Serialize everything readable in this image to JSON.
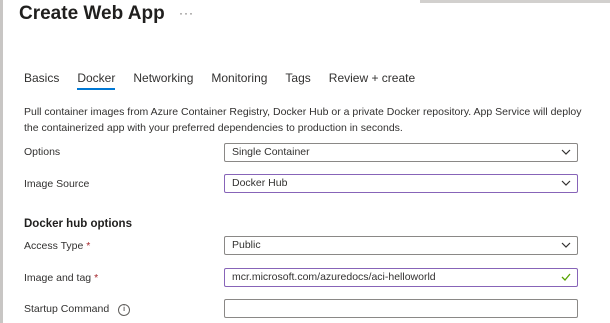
{
  "window": {
    "title": "Create Web App",
    "more_label": "···"
  },
  "tabs": [
    {
      "label": "Basics"
    },
    {
      "label": "Docker",
      "active": true
    },
    {
      "label": "Networking"
    },
    {
      "label": "Monitoring"
    },
    {
      "label": "Tags"
    },
    {
      "label": "Review + create"
    }
  ],
  "description": "Pull container images from Azure Container Registry, Docker Hub or a private Docker repository. App Service will deploy the containerized app with your preferred dependencies to production in seconds.",
  "form": {
    "options": {
      "label": "Options",
      "value": "Single Container"
    },
    "image_source": {
      "label": "Image Source",
      "value": "Docker Hub"
    },
    "section_heading": "Docker hub options",
    "access_type": {
      "label": "Access Type",
      "required_marker": "*",
      "value": "Public"
    },
    "image_and_tag": {
      "label": "Image and tag",
      "required_marker": "*",
      "value": "mcr.microsoft.com/azuredocs/aci-helloworld"
    },
    "startup_command": {
      "label": "Startup Command",
      "value": ""
    }
  },
  "icons": {
    "dropdown": "chevron-down-icon",
    "valid": "checkmark-icon",
    "info": "info-icon"
  },
  "colors": {
    "accent": "#0078d4",
    "focus_border": "#8764b8",
    "required": "#a4262c",
    "valid": "#57a300"
  }
}
